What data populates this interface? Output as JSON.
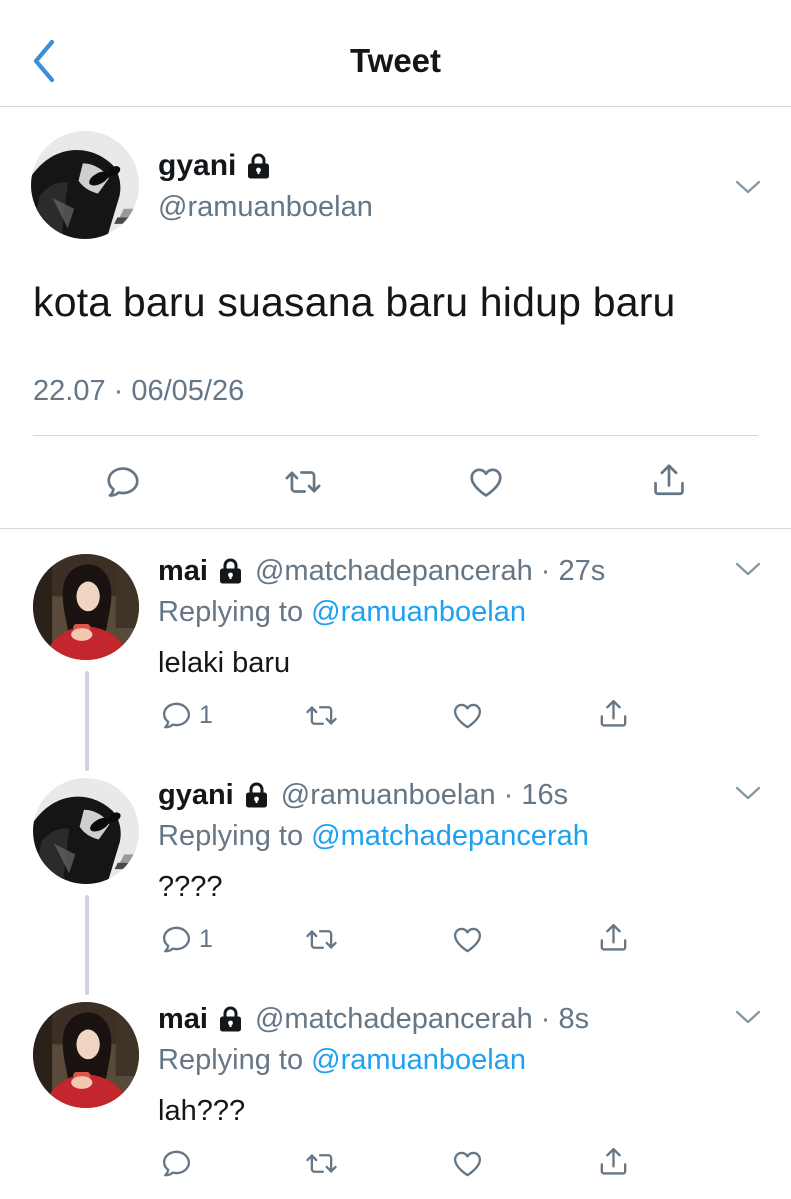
{
  "header": {
    "title": "Tweet"
  },
  "main_tweet": {
    "name": "gyani",
    "handle": "@ramuanboelan",
    "text": "kota baru suasana baru hidup baru",
    "timestamp": "22.07 · 06/05/26"
  },
  "replies": [
    {
      "name": "mai",
      "handle_time": "@matchadepancerah · 27s",
      "replying_prefix": "Replying to ",
      "replying_to": "@ramuanboelan",
      "text": "lelaki baru",
      "reply_count": "1"
    },
    {
      "name": "gyani",
      "handle_time": "@ramuanboelan · 16s",
      "replying_prefix": "Replying to ",
      "replying_to": "@matchadepancerah",
      "text": "????",
      "reply_count": "1"
    },
    {
      "name": "mai",
      "handle_time": "@matchadepancerah · 8s",
      "replying_prefix": "Replying to ",
      "replying_to": "@ramuanboelan",
      "text": "lah???",
      "reply_count": ""
    }
  ],
  "colors": {
    "accent": "#1da1f2",
    "secondary_text": "#657786",
    "primary_text": "#14171a",
    "border": "#d6d9dc",
    "back_arrow": "#3a8fd8"
  },
  "icons": [
    "back-chevron-icon",
    "lock-icon",
    "chevron-down-icon",
    "reply-icon",
    "retweet-icon",
    "like-icon",
    "share-icon"
  ]
}
